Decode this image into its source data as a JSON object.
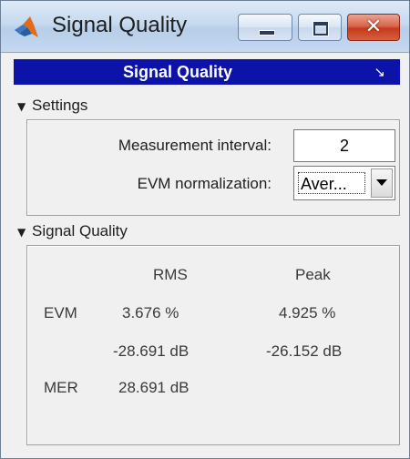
{
  "window": {
    "title": "Signal Quality",
    "icons": {
      "app": "matlab-icon",
      "minimize": "minimize-icon",
      "maximize": "maximize-icon",
      "close": "close-icon"
    },
    "close_glyph": "✕"
  },
  "panel": {
    "title": "Signal Quality",
    "undock_glyph": "↘",
    "header_color": "#0d12a8"
  },
  "settings": {
    "section_label": "Settings",
    "expanded_glyph": "▼",
    "measurement_interval_label": "Measurement interval:",
    "measurement_interval_value": "2",
    "evm_normalization_label": "EVM normalization:",
    "evm_normalization_value": "Aver..."
  },
  "quality": {
    "section_label": "Signal Quality",
    "expanded_glyph": "▼",
    "columns": [
      "RMS",
      "Peak"
    ],
    "rows": {
      "evm": {
        "label": "EVM",
        "rms_percent": "3.676 %",
        "peak_percent": "4.925 %",
        "rms_db": "-28.691 dB",
        "peak_db": "-26.152 dB"
      },
      "mer": {
        "label": "MER",
        "rms_db": "28.691 dB"
      }
    }
  }
}
